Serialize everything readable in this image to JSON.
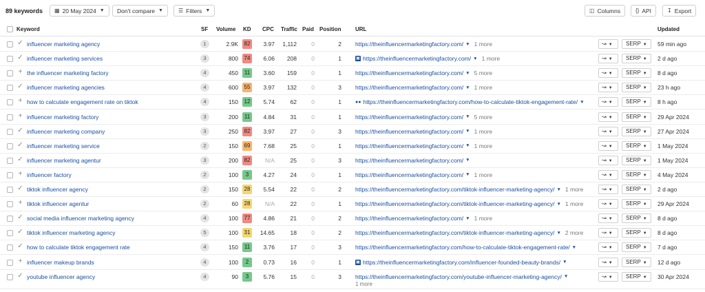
{
  "toolbar": {
    "keyword_count": "89 keywords",
    "date_label": "20 May 2024",
    "date_icon": "calendar-icon",
    "compare_label": "Don't compare",
    "filters_label": "Filters",
    "filters_icon": "filter-icon",
    "columns_label": "Columns",
    "columns_icon": "columns-icon",
    "api_label": "API",
    "api_icon": "code-braces-icon",
    "export_label": "Export",
    "export_icon": "download-icon"
  },
  "headers": {
    "keyword": "Keyword",
    "sf": "SF",
    "volume": "Volume",
    "kd": "KD",
    "cpc": "CPC",
    "traffic": "Traffic",
    "paid": "Paid",
    "position": "Position",
    "url": "URL",
    "updated": "Updated"
  },
  "controls": {
    "serp_label": "SERP"
  },
  "colors": {
    "kd_red": "#f08a82",
    "kd_orange": "#f7b46b",
    "kd_yellow": "#f5d66f",
    "kd_green": "#74c98b",
    "link": "#1a4fa3"
  },
  "rows": [
    {
      "status": "check",
      "keyword": "influencer marketing agency",
      "sf": "1",
      "volume": "2.9K",
      "kd": "82",
      "kd_color": "red",
      "cpc": "3.97",
      "traffic": "1,112",
      "paid": "0",
      "position": "2",
      "url_icon": "",
      "url": "https://theinfluencermarketingfactory.com/",
      "more": "1 more",
      "more_below": "",
      "updated": "59 min ago"
    },
    {
      "status": "check",
      "keyword": "influencer marketing services",
      "sf": "3",
      "volume": "800",
      "kd": "74",
      "kd_color": "red",
      "cpc": "6.06",
      "traffic": "208",
      "paid": "0",
      "position": "1",
      "url_icon": "image",
      "url": "https://theinfluencermarketingfactory.com/",
      "more": "1 more",
      "more_below": "",
      "updated": "2 d ago"
    },
    {
      "status": "plus",
      "keyword": "the influencer marketing factory",
      "sf": "4",
      "volume": "450",
      "kd": "11",
      "kd_color": "green",
      "cpc": "3.60",
      "traffic": "159",
      "paid": "0",
      "position": "1",
      "url_icon": "",
      "url": "https://theinfluencermarketingfactory.com/",
      "more": "5 more",
      "more_below": "",
      "updated": "8 d ago"
    },
    {
      "status": "check",
      "keyword": "influencer marketing agencies",
      "sf": "4",
      "volume": "600",
      "kd": "55",
      "kd_color": "orange",
      "cpc": "3.97",
      "traffic": "132",
      "paid": "0",
      "position": "3",
      "url_icon": "",
      "url": "https://theinfluencermarketingfactory.com/",
      "more": "1 more",
      "more_below": "",
      "updated": "23 h ago"
    },
    {
      "status": "plus",
      "keyword": "how to calculate engagement rate on tiktok",
      "sf": "4",
      "volume": "150",
      "kd": "12",
      "kd_color": "green",
      "cpc": "5.74",
      "traffic": "62",
      "paid": "0",
      "position": "1",
      "url_icon": "double",
      "url": "https://theinfluencermarketingfactory.com/how-to-calculate-tiktok-engagement-rate/",
      "more": "",
      "more_below": "",
      "updated": "8 h ago"
    },
    {
      "status": "plus",
      "keyword": "influencer marketing factory",
      "sf": "3",
      "volume": "200",
      "kd": "11",
      "kd_color": "green",
      "cpc": "4.84",
      "traffic": "31",
      "paid": "0",
      "position": "1",
      "url_icon": "",
      "url": "https://theinfluencermarketingfactory.com/",
      "more": "5 more",
      "more_below": "",
      "updated": "29 Apr 2024"
    },
    {
      "status": "check",
      "keyword": "influencer marketing company",
      "sf": "3",
      "volume": "250",
      "kd": "82",
      "kd_color": "red",
      "cpc": "3.97",
      "traffic": "27",
      "paid": "0",
      "position": "3",
      "url_icon": "",
      "url": "https://theinfluencermarketingfactory.com/",
      "more": "1 more",
      "more_below": "",
      "updated": "27 Apr 2024"
    },
    {
      "status": "check",
      "keyword": "influencer marketing service",
      "sf": "2",
      "volume": "150",
      "kd": "69",
      "kd_color": "orange",
      "cpc": "7.68",
      "traffic": "25",
      "paid": "0",
      "position": "1",
      "url_icon": "",
      "url": "https://theinfluencermarketingfactory.com/",
      "more": "1 more",
      "more_below": "",
      "updated": "1 May 2024"
    },
    {
      "status": "check",
      "keyword": "influencer marketing agentur",
      "sf": "3",
      "volume": "200",
      "kd": "82",
      "kd_color": "red",
      "cpc": "N/A",
      "traffic": "25",
      "paid": "0",
      "position": "3",
      "url_icon": "",
      "url": "https://theinfluencermarketingfactory.com/",
      "more": "",
      "more_below": "",
      "updated": "1 May 2024"
    },
    {
      "status": "plus",
      "keyword": "influencer factory",
      "sf": "2",
      "volume": "100",
      "kd": "3",
      "kd_color": "green",
      "cpc": "4.27",
      "traffic": "24",
      "paid": "0",
      "position": "1",
      "url_icon": "",
      "url": "https://theinfluencermarketingfactory.com/",
      "more": "1 more",
      "more_below": "",
      "updated": "4 May 2024"
    },
    {
      "status": "check",
      "keyword": "tiktok influencer agency",
      "sf": "2",
      "volume": "150",
      "kd": "28",
      "kd_color": "yellow",
      "cpc": "5.54",
      "traffic": "22",
      "paid": "0",
      "position": "2",
      "url_icon": "",
      "url": "https://theinfluencermarketingfactory.com/tiktok-influencer-marketing-agency/",
      "more": "1 more",
      "more_below": "",
      "updated": "2 d ago"
    },
    {
      "status": "plus",
      "keyword": "tiktok influencer agentur",
      "sf": "2",
      "volume": "60",
      "kd": "28",
      "kd_color": "yellow",
      "cpc": "N/A",
      "traffic": "22",
      "paid": "0",
      "position": "1",
      "url_icon": "",
      "url": "https://theinfluencermarketingfactory.com/tiktok-influencer-marketing-agency/",
      "more": "1 more",
      "more_below": "",
      "updated": "29 Apr 2024"
    },
    {
      "status": "check",
      "keyword": "social media influencer marketing agency",
      "sf": "4",
      "volume": "100",
      "kd": "77",
      "kd_color": "red",
      "cpc": "4.86",
      "traffic": "21",
      "paid": "0",
      "position": "2",
      "url_icon": "",
      "url": "https://theinfluencermarketingfactory.com/",
      "more": "1 more",
      "more_below": "",
      "updated": "8 d ago"
    },
    {
      "status": "check",
      "keyword": "tiktok influencer marketing agency",
      "sf": "5",
      "volume": "100",
      "kd": "31",
      "kd_color": "yellow",
      "cpc": "14.65",
      "traffic": "18",
      "paid": "0",
      "position": "2",
      "url_icon": "",
      "url": "https://theinfluencermarketingfactory.com/tiktok-influencer-marketing-agency/",
      "more": "2 more",
      "more_below": "",
      "updated": "8 d ago"
    },
    {
      "status": "check",
      "keyword": "how to calculate tiktok engagement rate",
      "sf": "4",
      "volume": "150",
      "kd": "11",
      "kd_color": "green",
      "cpc": "3.76",
      "traffic": "17",
      "paid": "0",
      "position": "3",
      "url_icon": "",
      "url": "https://theinfluencermarketingfactory.com/how-to-calculate-tiktok-engagement-rate/",
      "more": "",
      "more_below": "",
      "updated": "7 d ago"
    },
    {
      "status": "plus",
      "keyword": "influencer makeup brands",
      "sf": "4",
      "volume": "100",
      "kd": "2",
      "kd_color": "green",
      "cpc": "0.73",
      "traffic": "16",
      "paid": "0",
      "position": "1",
      "url_icon": "image",
      "url": "https://theinfluencermarketingfactory.com/influencer-founded-beauty-brands/",
      "more": "",
      "more_below": "",
      "updated": "12 d ago"
    },
    {
      "status": "check",
      "keyword": "youtube influencer agency",
      "sf": "4",
      "volume": "90",
      "kd": "3",
      "kd_color": "green",
      "cpc": "5.76",
      "traffic": "15",
      "paid": "0",
      "position": "3",
      "url_icon": "",
      "url": "https://theinfluencermarketingfactory.com/youtube-influencer-marketing-agency/",
      "more": "",
      "more_below": "1 more",
      "updated": "30 Apr 2024"
    }
  ]
}
